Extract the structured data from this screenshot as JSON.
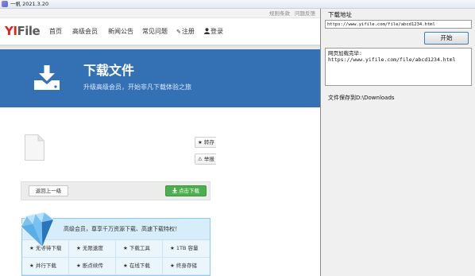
{
  "window": {
    "title": "一帆 2021.3.20",
    "icon": "app-icon"
  },
  "browser": {
    "top_links": [
      "规则条款",
      "问题反馈"
    ],
    "logo": {
      "accent": "YI",
      "rest": "File"
    },
    "nav": [
      {
        "label": "首页"
      },
      {
        "label": "高级会员"
      },
      {
        "label": "新闻公告"
      },
      {
        "label": "常见问题"
      },
      {
        "label": "注册",
        "icon": "pencil-icon"
      },
      {
        "label": "登录",
        "icon": "user-icon"
      }
    ],
    "banner": {
      "icon": "download-tray-icon",
      "title": "下载文件",
      "subtitle": "升级高级会员，开始非凡下载体验之旅"
    },
    "file": {
      "icon": "file-icon",
      "actions": [
        {
          "label": "转存",
          "icon": "star-icon"
        },
        {
          "label": "举报",
          "icon": "warning-icon"
        }
      ]
    },
    "action_bar": {
      "back_label": "返回上一级",
      "download_label": "点击下载",
      "download_icon": "download-icon"
    },
    "vip": {
      "badge_icon": "diamond-icon",
      "headline": "高级会员，尊享千万资源下载、高速下载特权！",
      "features": [
        "无等待下载",
        "无限速度",
        "下载工具",
        "1TB 容量",
        "并行下载",
        "断点续传",
        "在线下载",
        "终身存储"
      ]
    }
  },
  "panel": {
    "url_label": "下载地址",
    "url_value": "https://www.yifile.com/file/abcd1234.html",
    "start_label": "开始",
    "log": [
      "网页加载完毕:",
      "https://www.yifile.com/file/abcd1234.html"
    ],
    "save_path": "文件保存到D:\\Downloads"
  },
  "colors": {
    "brand_red": "#d9261c",
    "banner_blue": "#3471b4",
    "download_green": "#4cae4c",
    "vip_border": "#8ec9ee",
    "vip_bg": "#eaf5fc"
  }
}
